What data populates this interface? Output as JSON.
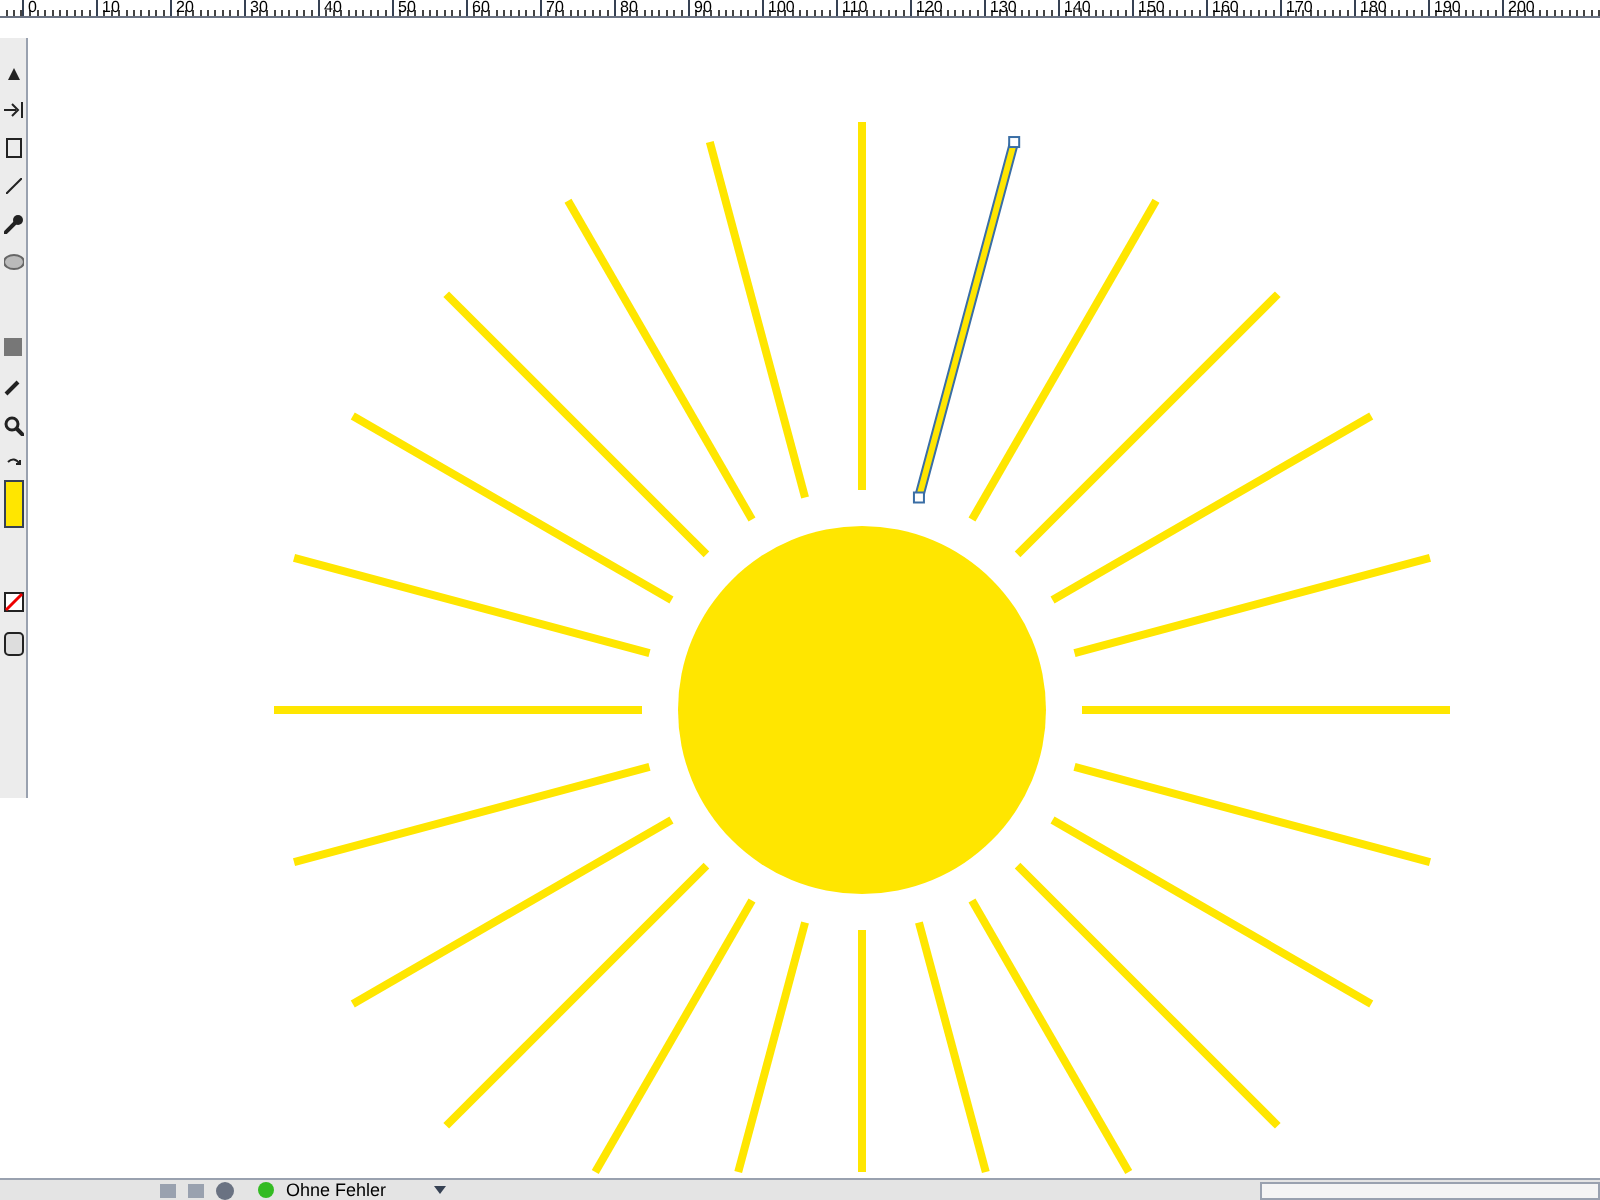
{
  "ruler": {
    "labels": [
      "0",
      "10",
      "20",
      "30",
      "40",
      "50",
      "60",
      "70",
      "80",
      "90",
      "100",
      "110",
      "120",
      "130",
      "140",
      "150",
      "160",
      "170",
      "180",
      "190",
      "200"
    ]
  },
  "sun": {
    "color": "#ffe600",
    "rays": [
      {
        "selected": false
      },
      {
        "selected": true
      },
      {
        "selected": false
      },
      {
        "selected": false
      },
      {
        "selected": false
      },
      {
        "selected": false
      },
      {
        "selected": false
      },
      {
        "selected": false
      },
      {
        "selected": false
      },
      {
        "selected": false
      },
      {
        "selected": false
      },
      {
        "selected": false
      },
      {
        "selected": false
      },
      {
        "selected": false
      },
      {
        "selected": false
      },
      {
        "selected": false
      },
      {
        "selected": false
      },
      {
        "selected": false
      },
      {
        "selected": false
      },
      {
        "selected": false
      },
      {
        "selected": false
      },
      {
        "selected": false
      },
      {
        "selected": false
      },
      {
        "selected": false
      }
    ]
  },
  "status_bar": {
    "status": "Ohne Fehler"
  }
}
